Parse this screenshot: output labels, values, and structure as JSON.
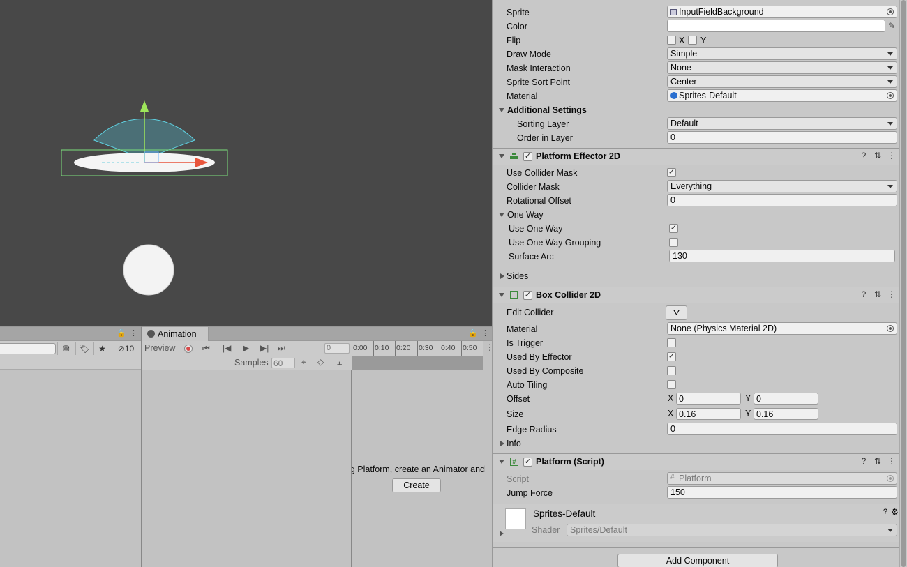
{
  "scene": {},
  "hierarchy": {
    "hidden_count": "10"
  },
  "animation": {
    "tab_label": "Animation",
    "preview_label": "Preview",
    "frame_value": "0",
    "samples_label": "Samples",
    "samples_value": "60",
    "ticks": [
      "0:00",
      "0:10",
      "0:20",
      "0:30",
      "0:40",
      "0:50"
    ],
    "message": "g Platform, create an Animator and",
    "create_label": "Create"
  },
  "inspector": {
    "sprite_renderer": {
      "sprite_label": "Sprite",
      "sprite_value": "InputFieldBackground",
      "color_label": "Color",
      "flip_label": "Flip",
      "flip_x": "X",
      "flip_y": "Y",
      "draw_mode_label": "Draw Mode",
      "draw_mode_value": "Simple",
      "mask_label": "Mask Interaction",
      "mask_value": "None",
      "sort_point_label": "Sprite Sort Point",
      "sort_point_value": "Center",
      "material_label": "Material",
      "material_value": "Sprites-Default",
      "additional_label": "Additional Settings",
      "sorting_layer_label": "Sorting Layer",
      "sorting_layer_value": "Default",
      "order_label": "Order in Layer",
      "order_value": "0"
    },
    "platform_effector": {
      "title": "Platform Effector 2D",
      "use_mask_label": "Use Collider Mask",
      "mask_label": "Collider Mask",
      "mask_value": "Everything",
      "rot_label": "Rotational Offset",
      "rot_value": "0",
      "one_way_label": "One Way",
      "use_one_way_label": "Use One Way",
      "grouping_label": "Use One Way Grouping",
      "arc_label": "Surface Arc",
      "arc_value": "130",
      "sides_label": "Sides"
    },
    "box_collider": {
      "title": "Box Collider 2D",
      "edit_label": "Edit Collider",
      "material_label": "Material",
      "material_value": "None (Physics Material 2D)",
      "trigger_label": "Is Trigger",
      "effector_label": "Used By Effector",
      "composite_label": "Used By Composite",
      "tiling_label": "Auto Tiling",
      "offset_label": "Offset",
      "offset_x": "0",
      "offset_y": "0",
      "size_label": "Size",
      "size_x": "0.16",
      "size_y": "0.16",
      "x_label": "X",
      "y_label": "Y",
      "radius_label": "Edge Radius",
      "radius_value": "0",
      "info_label": "Info"
    },
    "platform_script": {
      "title": "Platform (Script)",
      "script_label": "Script",
      "script_value": "Platform",
      "jump_label": "Jump Force",
      "jump_value": "150"
    },
    "material": {
      "name": "Sprites-Default",
      "shader_label": "Shader",
      "shader_value": "Sprites/Default"
    },
    "add_component": "Add Component"
  }
}
